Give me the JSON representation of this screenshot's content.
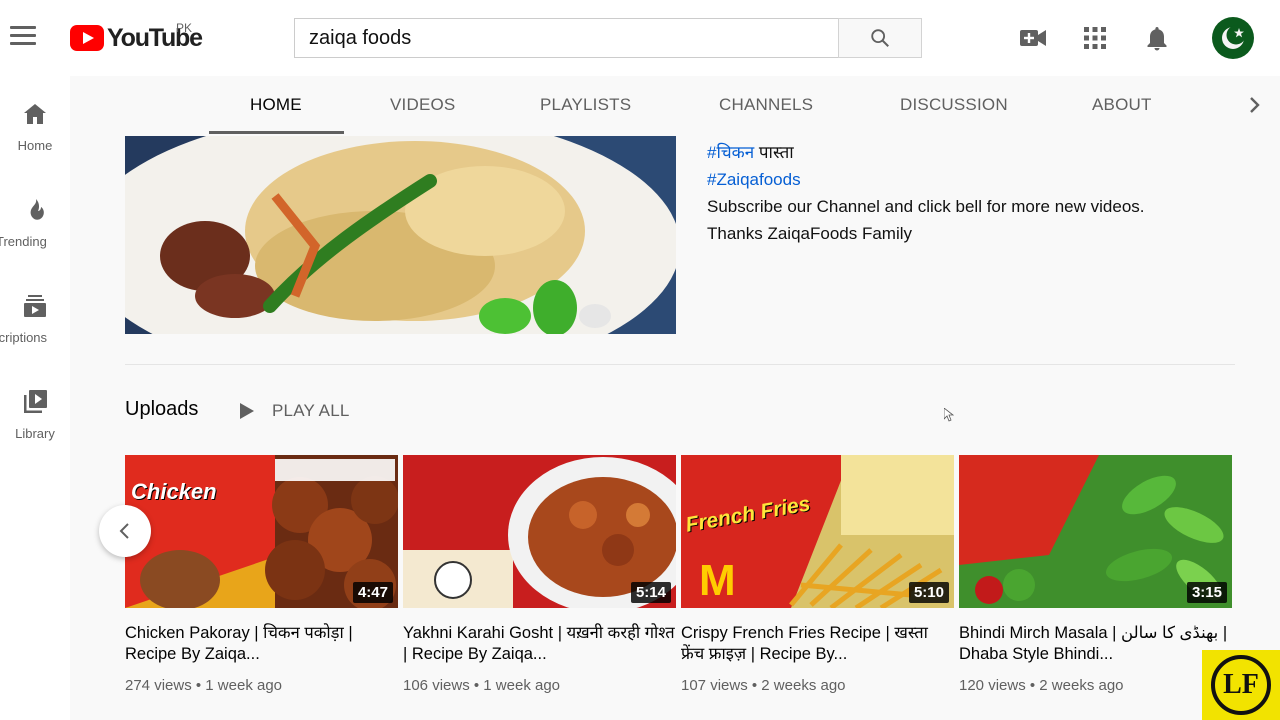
{
  "header": {
    "logo_text": "YouTube",
    "country_code": "PK",
    "search_value": "zaiqa foods",
    "icons": [
      "menu-icon",
      "search-icon",
      "create-video-icon",
      "apps-grid-icon",
      "notifications-bell-icon",
      "account-avatar"
    ]
  },
  "sidebar": {
    "items": [
      {
        "label": "Home",
        "icon": "home-icon"
      },
      {
        "label": "Trending",
        "icon": "trending-flame-icon"
      },
      {
        "label": "Subscriptions",
        "icon": "subscriptions-icon"
      },
      {
        "label": "Library",
        "icon": "library-icon"
      }
    ]
  },
  "tabs": {
    "items": [
      "HOME",
      "VIDEOS",
      "PLAYLISTS",
      "CHANNELS",
      "DISCUSSION",
      "ABOUT"
    ],
    "active": "HOME"
  },
  "featured": {
    "description_lines": [
      "#चिकन",
      "पास्ता",
      "#Zaiqafoods",
      "Subscribe our Channel and click bell for more new videos.",
      "Thanks ZaiqaFoods Family"
    ]
  },
  "shelf": {
    "title": "Uploads",
    "play_all": "PLAY ALL"
  },
  "videos": [
    {
      "title": "Chicken Pakoray | चिकन पकोड़ा | Recipe By Zaiqa...",
      "views": "274 views",
      "age": "1 week ago",
      "duration": "4:47",
      "thumb_text": "Chicken"
    },
    {
      "title": "Yakhni Karahi Gosht | यख़नी करही गोश्त | Recipe By Zaiqa...",
      "views": "106 views",
      "age": "1 week ago",
      "duration": "5:14",
      "thumb_text": ""
    },
    {
      "title": "Crispy French Fries Recipe | खस्ता फ्रेंच फ्राइज़ | Recipe By...",
      "views": "107 views",
      "age": "2 weeks ago",
      "duration": "5:10",
      "thumb_text": "French Fries"
    },
    {
      "title": "Bhindi Mirch Masala | بھنڈی کا سالن | Dhaba Style Bhindi...",
      "views": "120 views",
      "age": "2 weeks ago",
      "duration": "3:15",
      "thumb_text": ""
    }
  ],
  "watermark": {
    "text": "LF"
  },
  "colors": {
    "brand_red": "#ff0000",
    "link_blue": "#065fd4",
    "watermark_yellow": "#f2e300"
  }
}
